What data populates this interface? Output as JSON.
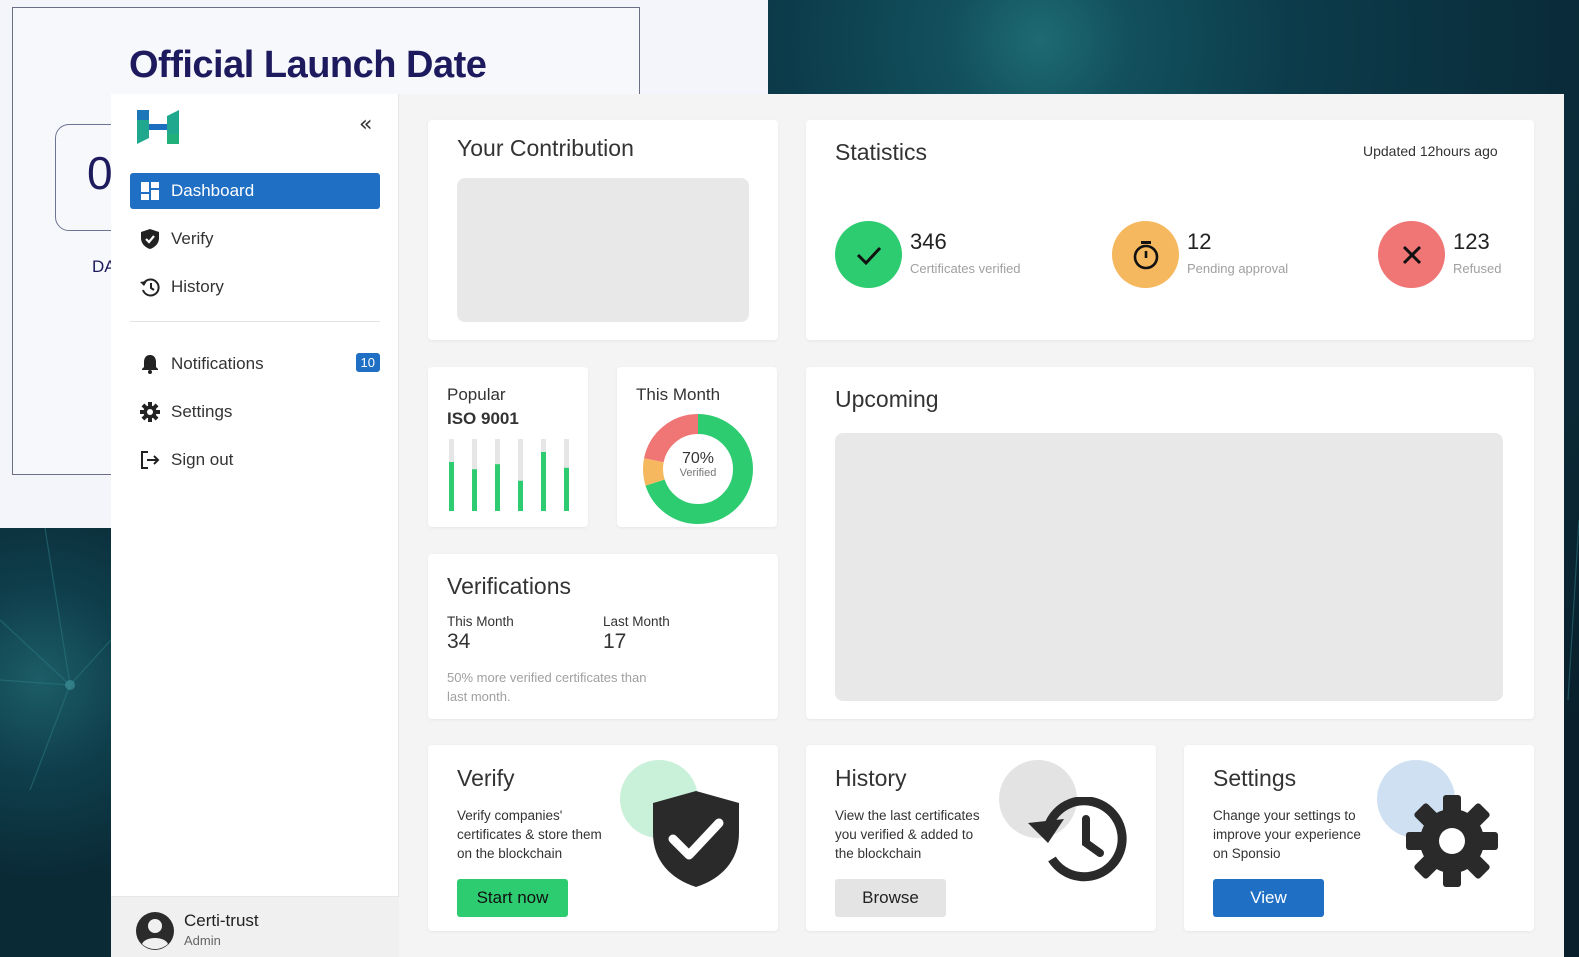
{
  "background": {
    "launch_title": "Official Launch Date",
    "launch_digit": "0",
    "launch_label": "DA"
  },
  "sidebar": {
    "collapse_label": "«",
    "items": [
      {
        "label": "Dashboard",
        "icon": "dashboard-icon",
        "active": true
      },
      {
        "label": "Verify",
        "icon": "shield-check-icon"
      },
      {
        "label": "History",
        "icon": "history-icon"
      },
      {
        "label": "Notifications",
        "icon": "bell-icon",
        "badge": "10"
      },
      {
        "label": "Settings",
        "icon": "gear-icon"
      },
      {
        "label": "Sign out",
        "icon": "sign-out-icon"
      }
    ],
    "user": {
      "name": "Certi-trust",
      "role": "Admin"
    }
  },
  "contribution": {
    "title": "Your Contribution"
  },
  "statistics": {
    "title": "Statistics",
    "updated": "Updated 12hours ago",
    "verified": {
      "value": "346",
      "label": "Certificates verified",
      "color": "#2ecc71"
    },
    "pending": {
      "value": "12",
      "label": "Pending approval",
      "color": "#f5b85e"
    },
    "refused": {
      "value": "123",
      "label": "Refused",
      "color": "#f07575"
    }
  },
  "popular": {
    "title": "Popular",
    "name": "ISO 9001",
    "bars": [
      0.68,
      0.58,
      0.65,
      0.42,
      0.82,
      0.6
    ]
  },
  "this_month": {
    "title": "This Month",
    "percent": "70%",
    "caption": "Verified",
    "segments": [
      {
        "name": "Verified",
        "fraction": 0.7,
        "color": "#2ecc71"
      },
      {
        "name": "Pending",
        "fraction": 0.08,
        "color": "#f5b85e"
      },
      {
        "name": "Refused",
        "fraction": 0.22,
        "color": "#f07575"
      }
    ]
  },
  "verifications": {
    "title": "Verifications",
    "this_month_label": "This Month",
    "this_month_value": "34",
    "last_month_label": "Last Month",
    "last_month_value": "17",
    "note_line1": "50% more verified certificates than",
    "note_line2": "last month."
  },
  "upcoming": {
    "title": "Upcoming"
  },
  "verify_card": {
    "title": "Verify",
    "lines": [
      "Verify companies'",
      "certificates & store them",
      "on the blockchain"
    ],
    "button": "Start now",
    "accent": "#2ecc71"
  },
  "history_card": {
    "title": "History",
    "lines": [
      "View the last certificates",
      "you verified & added to",
      "the blockchain"
    ],
    "button": "Browse"
  },
  "settings_card": {
    "title": "Settings",
    "lines": [
      "Change your settings to",
      "improve your experience",
      "on Sponsio"
    ],
    "button": "View",
    "accent": "#1f6fc5"
  }
}
